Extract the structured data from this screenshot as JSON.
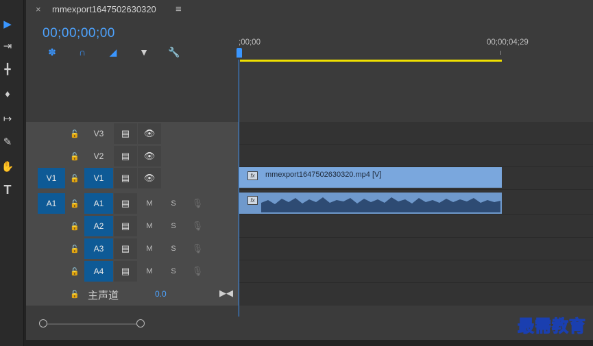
{
  "sequence": {
    "tab_title": "mmexport1647502630320",
    "timecode": "00;00;00;00",
    "close_glyph": "×",
    "menu_glyph": "≡"
  },
  "ruler": {
    "start_label": ";00;00",
    "end_label": "00;00;04;29"
  },
  "tools": [
    "selection-tool-icon",
    "track-select-icon",
    "ripple-edit-icon",
    "razor-icon",
    "slip-icon",
    "pen-icon",
    "hand-icon",
    "type-icon"
  ],
  "timeline_controls": [
    "snap-icon",
    "linked-selection-icon",
    "add-marker-icon",
    "marker-icon",
    "wrench-icon"
  ],
  "tracks": {
    "video": [
      {
        "name": "V3",
        "source_patch": ""
      },
      {
        "name": "V2",
        "source_patch": ""
      },
      {
        "name": "V1",
        "source_patch": "V1"
      }
    ],
    "audio": [
      {
        "name": "A1",
        "source_patch": "A1",
        "mute": "M",
        "solo": "S"
      },
      {
        "name": "A2",
        "source_patch": "",
        "mute": "M",
        "solo": "S"
      },
      {
        "name": "A3",
        "source_patch": "",
        "mute": "M",
        "solo": "S"
      },
      {
        "name": "A4",
        "source_patch": "",
        "mute": "M",
        "solo": "S"
      }
    ],
    "master": {
      "label": "主声道",
      "value": "0.0"
    }
  },
  "clips": {
    "video_clip_name": "mmexport1647502630320.mp4 [V]",
    "fx_badge": "fx"
  },
  "colors": {
    "accent_blue": "#3a96ff",
    "patch_blue": "#0e5a96",
    "clip_blue": "#7aa7dd",
    "work_area": "#f0e000"
  },
  "watermark": "最需教育"
}
